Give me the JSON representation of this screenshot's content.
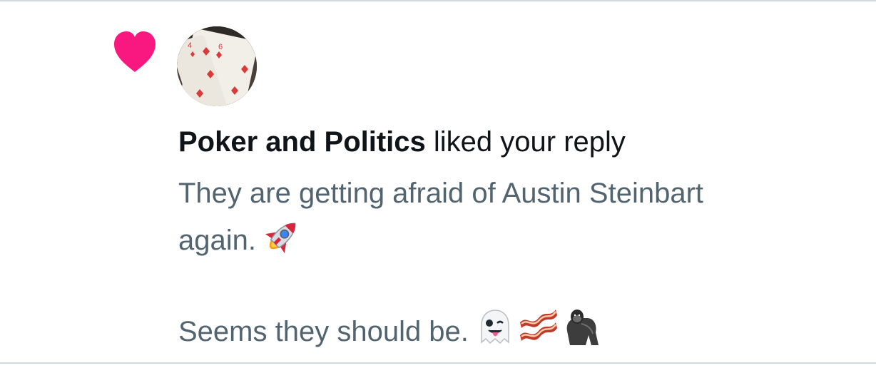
{
  "notification": {
    "author_name": "Poker and Politics",
    "action_text": " liked your reply",
    "icon": "heart-icon",
    "accent_color": "#f91880",
    "avatar_icon": "playing-card-avatar"
  },
  "reply": {
    "line1": "They are getting afraid of Austin Steinbart",
    "line2": "again.",
    "line2_emoji": [
      "rocket-icon"
    ],
    "line3": "Seems they should be.",
    "line3_emoji": [
      "ghost-tongue-icon",
      "bacon-icon",
      "gorilla-icon"
    ]
  }
}
